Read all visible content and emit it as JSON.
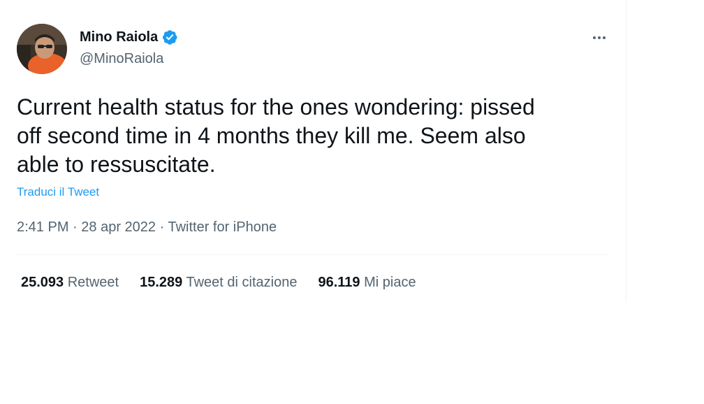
{
  "author": {
    "display_name": "Mino Raiola",
    "handle": "@MinoRaiola",
    "verified": true,
    "verified_color": "#1d9bf0"
  },
  "tweet": {
    "text": "Current health status for the ones wondering: pissed\noff second time in 4 months they kill me. Seem also\nable to ressuscitate.",
    "translate_label": "Traduci il Tweet",
    "time": "2:41 PM",
    "date": "28 apr 2022",
    "source": "Twitter for iPhone",
    "separator": " · "
  },
  "stats": [
    {
      "count": "25.093",
      "label": "Retweet"
    },
    {
      "count": "15.289",
      "label": "Tweet di citazione"
    },
    {
      "count": "96.119",
      "label": "Mi piace"
    }
  ],
  "icons": {
    "more": "more-horizontal-icon",
    "verified": "verified-badge-icon"
  },
  "colors": {
    "text": "#0f1419",
    "secondary": "#536471",
    "link": "#1d9bf0"
  }
}
